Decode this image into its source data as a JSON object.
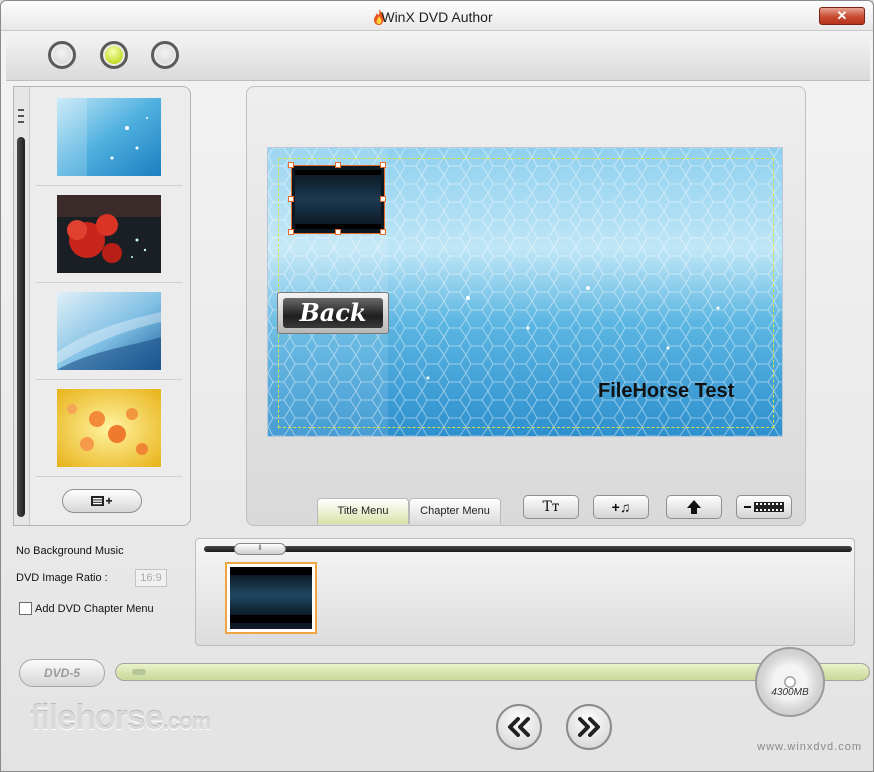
{
  "window": {
    "title": "WinX DVD Author",
    "close_label": "✕"
  },
  "top_bar": {
    "buttons": [
      {
        "name": "step-1-button",
        "active": false
      },
      {
        "name": "step-2-button",
        "active": true
      },
      {
        "name": "step-3-button",
        "active": false
      }
    ]
  },
  "backgrounds": [
    {
      "name": "background-blue-sparkle"
    },
    {
      "name": "background-red-roses"
    },
    {
      "name": "background-blue-wave"
    },
    {
      "name": "background-yellow-flowers"
    }
  ],
  "preview": {
    "back_label": "Back",
    "title_text": "FileHorse Test"
  },
  "tabs": [
    {
      "label": "Title Menu",
      "active": true
    },
    {
      "label": "Chapter Menu",
      "active": false
    }
  ],
  "tools": {
    "text_label": "Tт",
    "add_music_label": "+♫"
  },
  "settings": {
    "music_label": "No Background Music",
    "ratio_label": "DVD Image Ratio :",
    "ratio_value": "16:9",
    "chapter_label": "Add DVD Chapter Menu",
    "chapter_checked": false
  },
  "bottom": {
    "dvd_type": "DVD-5",
    "disc_capacity": "4300MB",
    "site": "www.winxdvd.com",
    "watermark_main": "filehorse",
    "watermark_suffix": ".com",
    "usage_fraction": 0.02
  },
  "colors": {
    "accent_green": "#c5dd2a",
    "selection_orange": "#e46a2a"
  }
}
